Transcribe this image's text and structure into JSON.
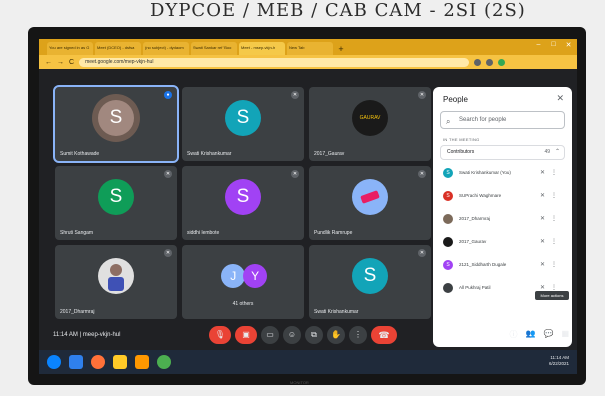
{
  "wall_text": "DYPCOE / MEB / CAB CAM - 2SI (2S)",
  "browser": {
    "tabs": [
      {
        "label": "You are signed in as G",
        "active": false
      },
      {
        "label": "Meet (DCEO) - dsfsa",
        "active": false
      },
      {
        "label": "(no subject) - dydaom",
        "active": false
      },
      {
        "label": "Swati Sankar ref 'Boo",
        "active": false
      },
      {
        "label": "Meet - msep-vkjn-h",
        "active": true
      },
      {
        "label": "New Tab",
        "active": false
      }
    ],
    "new_tab": "+",
    "url": "meet.google.com/mep-vkjn-hul",
    "back": "←",
    "forward": "→",
    "reload": "C"
  },
  "tiles": [
    {
      "initial": "S",
      "name": "Sumit Kothawade",
      "color": "#a1887f",
      "active": true
    },
    {
      "initial": "S",
      "name": "Swati Krishankumar",
      "color": "#12a4b8"
    },
    {
      "initial": "",
      "name": "2017_Gaurav",
      "color": "#1a1a1a",
      "logo": "GAURAV"
    },
    {
      "initial": "S",
      "name": "Shruti Sangam",
      "color": "#0f9d58"
    },
    {
      "initial": "S",
      "name": "siddhi lembote",
      "color": "#a142f4"
    },
    {
      "initial": "",
      "name": "Pundlik Ramrupe",
      "color": "#8ab4f8",
      "picture": true
    },
    {
      "initial": "",
      "name": "2017_Dharmraj",
      "color": "#e0e0e0",
      "picture": true
    },
    {
      "initial": "J",
      "initial2": "Y",
      "name": "41 others",
      "color": "#8ab4f8",
      "color2": "#a142f4"
    },
    {
      "initial": "S",
      "name": "Swati Krishankumar",
      "color": "#12a4b8"
    }
  ],
  "people": {
    "title": "People",
    "search_placeholder": "Search for people",
    "section_label": "IN THE MEETING",
    "contributors_label": "Contributors",
    "contributors_count": "49",
    "list": [
      {
        "initial": "S",
        "name": "Swati Krishankumar (You)",
        "color": "#12a4b8"
      },
      {
        "initial": "S",
        "name": "SUPrachi Waghmare",
        "color": "#d93025"
      },
      {
        "initial": "",
        "name": "2017_Dharmraj",
        "color": "#7c6a5a"
      },
      {
        "initial": "",
        "name": "2017_Gaurav",
        "color": "#1a1a1a"
      },
      {
        "initial": "S",
        "name": "2121_Siddharth Dugale",
        "color": "#a142f4"
      },
      {
        "initial": "",
        "name": "All Pukhraj Patil",
        "color": "#3c4043"
      }
    ],
    "tooltip": "More actions"
  },
  "bottom": {
    "time_code": "11:14 AM | meep-vkjn-hul"
  },
  "taskbar": {
    "time": "11:14 AM",
    "date": "6/22/2021"
  },
  "monitor_brand": "MONITOR"
}
